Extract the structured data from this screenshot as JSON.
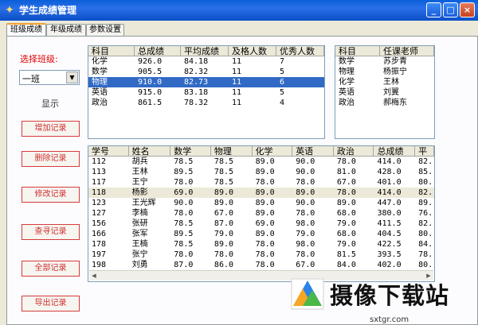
{
  "window": {
    "title": "学生成绩管理",
    "min_label": "_",
    "max_label": "□",
    "close_label": "×"
  },
  "tabs": [
    "班级成绩",
    "年级成绩",
    "参数设置"
  ],
  "sidebar": {
    "select_label": "选择班级:",
    "class_value": "一班",
    "show_label": "显示",
    "buttons": [
      "增加记录",
      "删除记录",
      "修改记录",
      "查寻记录",
      "全部记录",
      "导出记录"
    ]
  },
  "subjects_table": {
    "columns": [
      "科目",
      "总成绩",
      "平均成绩",
      "及格人数",
      "优秀人数"
    ],
    "rows": [
      [
        "化学",
        "926.0",
        "84.18",
        "11",
        "7"
      ],
      [
        "数学",
        "905.5",
        "82.32",
        "11",
        "5"
      ],
      [
        "物理",
        "910.0",
        "82.73",
        "11",
        "6"
      ],
      [
        "英语",
        "915.0",
        "83.18",
        "11",
        "5"
      ],
      [
        "政治",
        "861.5",
        "78.32",
        "11",
        "4"
      ]
    ],
    "selected_index": 2
  },
  "teachers_table": {
    "columns": [
      "科目",
      "任课老师"
    ],
    "rows": [
      [
        "数学",
        "苏步青"
      ],
      [
        "物理",
        "杨振宁"
      ],
      [
        "化学",
        "王林"
      ],
      [
        "英语",
        "刘翼"
      ],
      [
        "政治",
        "郝梅东"
      ]
    ]
  },
  "students_table": {
    "columns": [
      "学号",
      "姓名",
      "数学",
      "物理",
      "化学",
      "英语",
      "政治",
      "总成绩",
      "平"
    ],
    "rows": [
      [
        "112",
        "胡兵",
        "78.5",
        "78.5",
        "89.0",
        "90.0",
        "78.0",
        "414.0",
        "82."
      ],
      [
        "113",
        "王林",
        "89.5",
        "78.5",
        "89.0",
        "90.0",
        "81.0",
        "428.0",
        "85."
      ],
      [
        "117",
        "王宁",
        "78.0",
        "78.5",
        "78.0",
        "78.0",
        "67.0",
        "401.0",
        "80."
      ],
      [
        "118",
        "杨影",
        "69.0",
        "89.0",
        "89.0",
        "89.0",
        "78.0",
        "414.0",
        "82."
      ],
      [
        "123",
        "王光辉",
        "90.0",
        "89.0",
        "89.0",
        "90.0",
        "89.0",
        "447.0",
        "89."
      ],
      [
        "127",
        "李楠",
        "78.0",
        "67.0",
        "89.0",
        "78.0",
        "68.0",
        "380.0",
        "76."
      ],
      [
        "156",
        "张研",
        "78.5",
        "87.0",
        "69.0",
        "98.0",
        "79.0",
        "411.5",
        "82."
      ],
      [
        "166",
        "张军",
        "89.5",
        "79.0",
        "89.0",
        "79.0",
        "68.0",
        "404.5",
        "80."
      ],
      [
        "178",
        "王楠",
        "78.5",
        "89.0",
        "78.0",
        "98.0",
        "79.0",
        "422.5",
        "84."
      ],
      [
        "197",
        "张宁",
        "78.0",
        "78.0",
        "78.0",
        "78.0",
        "81.5",
        "393.5",
        "78."
      ],
      [
        "198",
        "刘勇",
        "87.0",
        "86.0",
        "78.0",
        "67.0",
        "84.0",
        "402.0",
        "80."
      ]
    ],
    "highlight_index": 3
  },
  "watermark": {
    "brand": "摄像下载站",
    "url": "sxtgr.com"
  }
}
